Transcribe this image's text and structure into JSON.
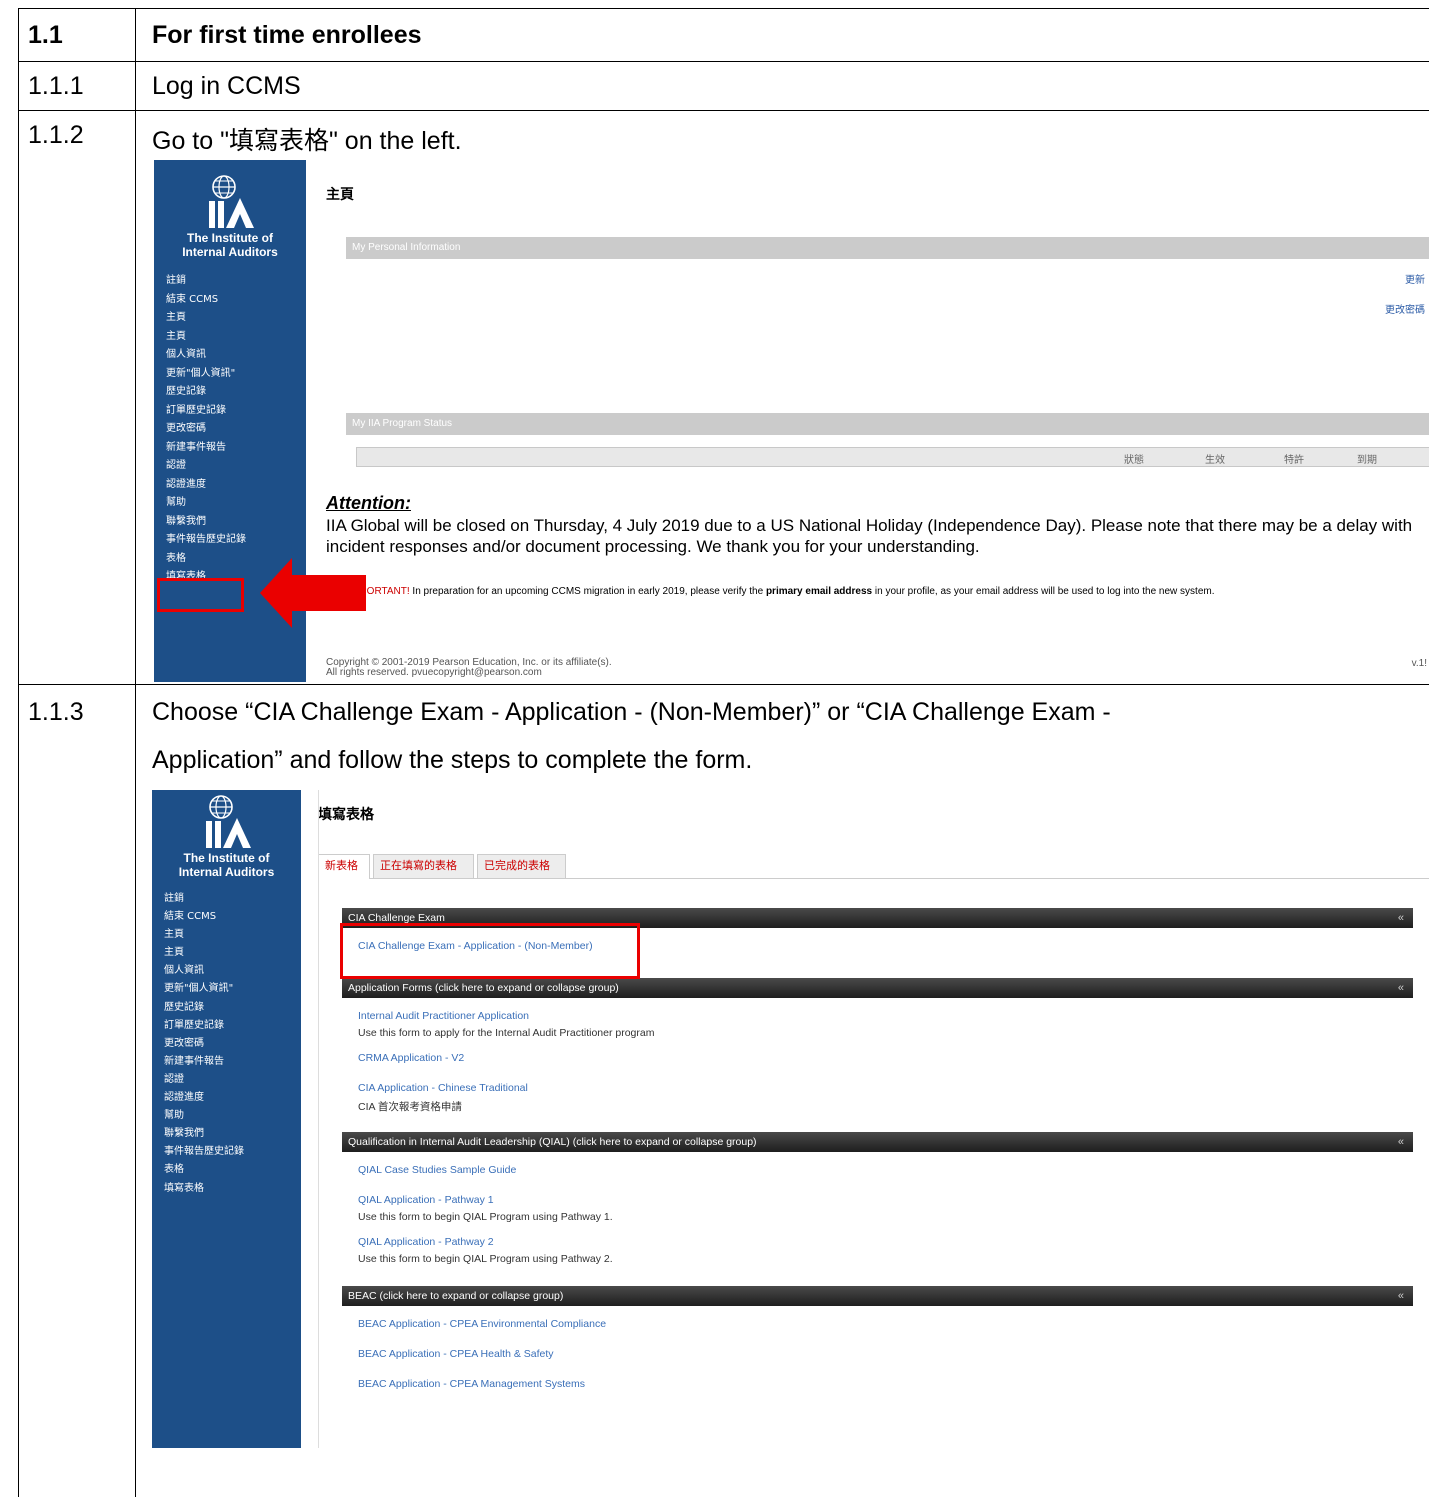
{
  "rows": [
    {
      "num": "1.1",
      "text": "For first time enrollees"
    },
    {
      "num": "1.1.1",
      "text": "Log in CCMS"
    },
    {
      "num": "1.1.2",
      "text": "Go to \"填寫表格\" on the left."
    },
    {
      "num": "1.1.3",
      "text_line1": "Choose “CIA Challenge Exam - Application - (Non-Member)” or “CIA Challenge Exam -",
      "text_line2": "Application” and follow the steps to complete the form."
    }
  ],
  "logo": {
    "line1": "The Institute of",
    "line2": "Internal Auditors"
  },
  "sidebar_menu": [
    {
      "label": "註銷",
      "type": "hdr"
    },
    {
      "label": "結束 CCMS",
      "type": "item"
    },
    {
      "label": "主頁",
      "type": "hdr"
    },
    {
      "label": "主頁",
      "type": "item"
    },
    {
      "label": "個人資訊",
      "type": "item"
    },
    {
      "label": "更新\"個人資訊\"",
      "type": "item"
    },
    {
      "label": "歷史記錄",
      "type": "item"
    },
    {
      "label": "訂單歷史記錄",
      "type": "item"
    },
    {
      "label": "更改密碼",
      "type": "item"
    },
    {
      "label": "新建事件報告",
      "type": "item"
    },
    {
      "label": "認證",
      "type": "hdr"
    },
    {
      "label": "認證進度",
      "type": "item"
    },
    {
      "label": "幫助",
      "type": "hdr"
    },
    {
      "label": "聯繫我們",
      "type": "item"
    },
    {
      "label": "事件報告歷史記錄",
      "type": "item"
    },
    {
      "label": "表格",
      "type": "hdr"
    },
    {
      "label": "填寫表格",
      "type": "item"
    }
  ],
  "screen1": {
    "page_title": "主頁",
    "personal_info_bar": "My Personal Information",
    "link_update": "更新",
    "link_change_pw": "更改密碼",
    "program_status_bar": "My IIA Program Status",
    "status_columns": [
      "狀態",
      "生效",
      "特許",
      "到期"
    ],
    "attention_title": "Attention:",
    "attention_body": "IIA Global will be closed on Thursday, 4 July 2019 due to a US National Holiday (Independence Day). Please note that there may be a delay with incident responses and/or document processing. We thank you for your understanding.",
    "important_label": "PORTANT!",
    "important_text_a": " In preparation for an upcoming CCMS migration in early 2019, please verify the ",
    "important_bold": "primary email address",
    "important_text_b": " in your profile, as your email address will be used to log into the new system.",
    "copyright_line1": "Copyright © 2001-2019 Pearson Education, Inc. or its affiliate(s).",
    "copyright_line2": "All rights reserved. pvuecopyright@pearson.com",
    "version": "v.1!"
  },
  "screen2": {
    "page_title": "填寫表格",
    "tabs": [
      "新表格",
      "正在填寫的表格",
      "已完成的表格"
    ],
    "groups": [
      {
        "title": "CIA Challenge Exam",
        "chev": "«",
        "forms": [
          {
            "link": "CIA Challenge Exam - Application - (Non-Member)",
            "desc": ""
          }
        ]
      },
      {
        "title": "Application Forms (click here to expand or collapse group)",
        "chev": "«",
        "forms": [
          {
            "link": "Internal Audit Practitioner Application",
            "desc": "Use this form to apply for the Internal Audit Practitioner program"
          },
          {
            "link": "CRMA Application - V2",
            "desc": ""
          },
          {
            "link": "CIA Application - Chinese Traditional",
            "desc": "CIA 首次報考資格申請"
          }
        ]
      },
      {
        "title": "Qualification in Internal Audit Leadership (QIAL) (click here to expand or collapse group)",
        "chev": "«",
        "forms": [
          {
            "link": "QIAL Case Studies Sample Guide",
            "desc": ""
          },
          {
            "link": "QIAL Application - Pathway 1",
            "desc": "Use this form to begin QIAL Program using Pathway 1."
          },
          {
            "link": "QIAL Application - Pathway 2",
            "desc": "Use this form to begin QIAL Program using Pathway 2."
          }
        ]
      },
      {
        "title": "BEAC (click here to expand or collapse group)",
        "chev": "«",
        "forms": [
          {
            "link": "BEAC Application - CPEA Environmental Compliance",
            "desc": ""
          },
          {
            "link": "BEAC Application - CPEA Health & Safety",
            "desc": ""
          },
          {
            "link": "BEAC Application - CPEA Management Systems",
            "desc": ""
          }
        ]
      }
    ]
  },
  "colors": {
    "sidebar": "#1d4f88",
    "highlight": "#ea0000",
    "link": "#3a6fb8"
  }
}
